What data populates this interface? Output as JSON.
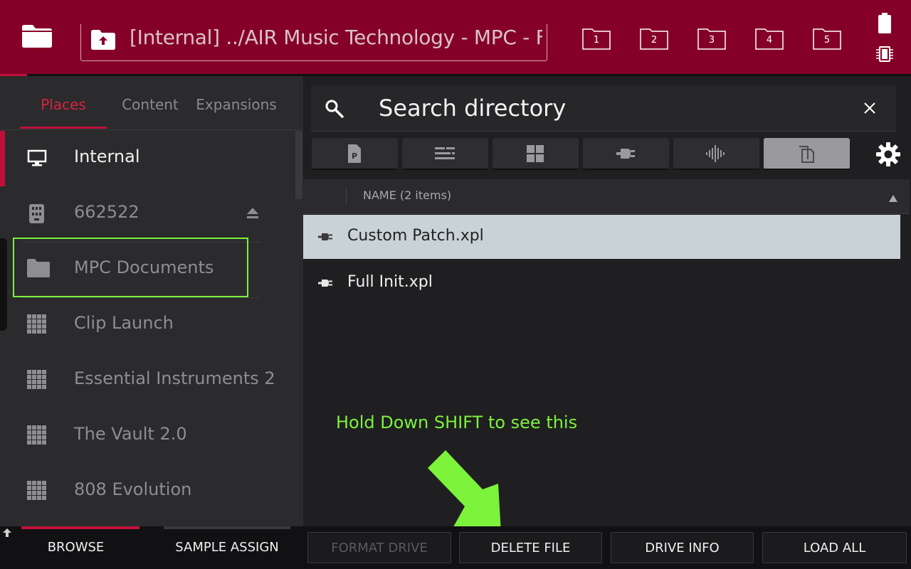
{
  "header": {
    "path": "[Internal] ../AIR Music Technology - MPC - Fa...",
    "slots": [
      "1",
      "2",
      "3",
      "4",
      "5"
    ],
    "icons": {
      "folder": "folder-icon",
      "path_up": "folder-up-icon",
      "battery": "battery-icon",
      "storage": "sd-card-icon"
    }
  },
  "left_tabs": [
    "Places",
    "Content",
    "Expansions"
  ],
  "places": [
    {
      "label": "Internal",
      "icon": "monitor-icon"
    },
    {
      "label": "662522",
      "icon": "drive-icon"
    },
    {
      "label": "MPC Documents",
      "icon": "folder-icon"
    },
    {
      "label": "Clip Launch",
      "icon": "grid-icon"
    },
    {
      "label": "Essential Instruments 2",
      "icon": "grid-icon"
    },
    {
      "label": "The Vault 2.0",
      "icon": "grid-icon"
    },
    {
      "label": "808 Evolution",
      "icon": "grid-icon"
    }
  ],
  "search": {
    "placeholder": "Search directory"
  },
  "filters": [
    "project-filter-icon",
    "sequence-filter-icon",
    "kit-filter-icon",
    "plugin-filter-icon",
    "sample-filter-icon",
    "all-files-filter-icon"
  ],
  "list": {
    "header": "NAME (2 items)",
    "items": [
      "Custom Patch.xpl",
      "Full Init.xpl"
    ]
  },
  "annotation": "Hold Down SHIFT to see this",
  "bottom_buttons": [
    "BROWSE",
    "SAMPLE ASSIGN",
    "FORMAT DRIVE",
    "DELETE FILE",
    "DRIVE INFO",
    "LOAD ALL"
  ],
  "colors": {
    "accent_red": "#c0103a",
    "topbar": "#850028",
    "highlight_green": "#7cf23b",
    "selected_row": "#c9d2d6"
  }
}
